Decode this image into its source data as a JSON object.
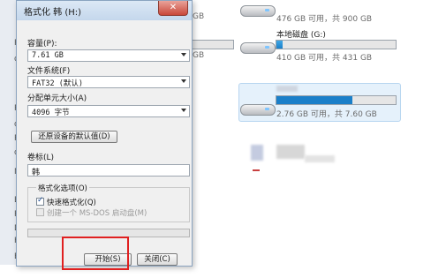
{
  "dialog": {
    "title": "格式化 韩 (H:)",
    "close_glyph": "✕",
    "capacity_label": "容量(P):",
    "capacity_value": "7.61 GB",
    "filesystem_label": "文件系统(F)",
    "filesystem_value": "FAT32 (默认)",
    "alloc_label": "分配单元大小(A)",
    "alloc_value": "4096 字节",
    "restore_defaults": "还原设备的默认值(D)",
    "volume_label": "卷标(L)",
    "volume_value": "韩",
    "options_title": "格式化选项(O)",
    "quick_format": "快速格式化(Q)",
    "quick_format_checked": true,
    "msdos_disk": "创建一个 MS-DOS 启动盘(M)",
    "msdos_checked": false,
    "progress": 0,
    "start_button": "开始(S)",
    "close_button": "关闭(C)",
    "highlight_color": "#e02020"
  },
  "explorer": {
    "fragments": {
      "gb_top": "GB",
      "gb_mid": "GB"
    },
    "drives": [
      {
        "name": "",
        "free_text": "476 GB 可用，共 900 GB"
      },
      {
        "name": "本地磁盘 (G:)",
        "free_text": "410 GB 可用，共 431 GB",
        "used_fraction": 0.05
      },
      {
        "name": "",
        "free_text": "2.76 GB 可用，共 7.60 GB",
        "used_fraction": 0.64,
        "selected": true
      }
    ],
    "left_letters": [
      "R",
      "d",
      "R",
      "d",
      "R",
      "d",
      "M",
      "B",
      "R",
      "D",
      "H",
      "E"
    ]
  },
  "colors": {
    "accent_bar": "#1a7fc9",
    "dialog_bg": "#f0f0f0"
  }
}
